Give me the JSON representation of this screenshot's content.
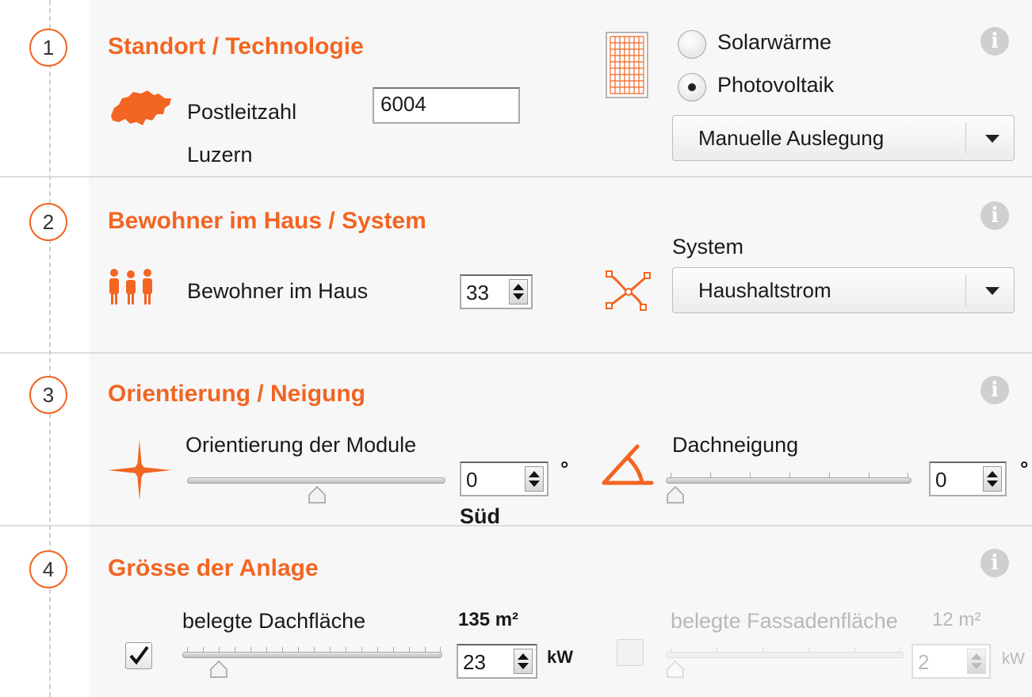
{
  "sections": [
    {
      "number": "1",
      "title": "Standort / Technologie",
      "info_icon": "info-icon",
      "location_icon": "switzerland-map-icon",
      "postcode_label": "Postleitzahl",
      "postcode_value": "6004",
      "city": "Luzern",
      "technology_icon": "solar-panel-icon",
      "technology_options": [
        {
          "label": "Solarwärme",
          "selected": false
        },
        {
          "label": "Photovoltaik",
          "selected": true
        }
      ],
      "design_dropdown": "Manuelle Auslegung"
    },
    {
      "number": "2",
      "title": "Bewohner im Haus / System",
      "info_icon": "info-icon",
      "residents_icon": "people-icon",
      "residents_label": "Bewohner im Haus",
      "residents_value": "33",
      "system_icon": "network-nodes-icon",
      "system_label": "System",
      "system_dropdown": "Haushaltstrom"
    },
    {
      "number": "3",
      "title": "Orientierung / Neigung",
      "info_icon": "info-icon",
      "orientation_icon": "compass-star-icon",
      "orientation_label": "Orientierung der Module",
      "orientation_value": "0",
      "orientation_unit": "°",
      "orientation_direction": "Süd",
      "orientation_slider_fraction": 0.5,
      "tilt_icon": "roof-angle-icon",
      "tilt_label": "Dachneigung",
      "tilt_value": "0",
      "tilt_unit": "°",
      "tilt_slider_fraction": 0.0
    },
    {
      "number": "4",
      "title": "Grösse der Anlage",
      "info_icon": "info-icon",
      "roof_checked": true,
      "roof_label": "belegte Dachfläche",
      "roof_area": "135 m²",
      "roof_value": "23",
      "roof_unit": "kW",
      "roof_slider_fraction": 0.1,
      "facade_checked": false,
      "facade_label": "belegte Fassadenfläche",
      "facade_area": "12 m²",
      "facade_value": "2",
      "facade_unit": "kW",
      "facade_slider_fraction": 0.0
    }
  ],
  "colors": {
    "accent": "#f26522",
    "panel": "#f7f7f7",
    "disabled_text": "#b8b8b8"
  }
}
